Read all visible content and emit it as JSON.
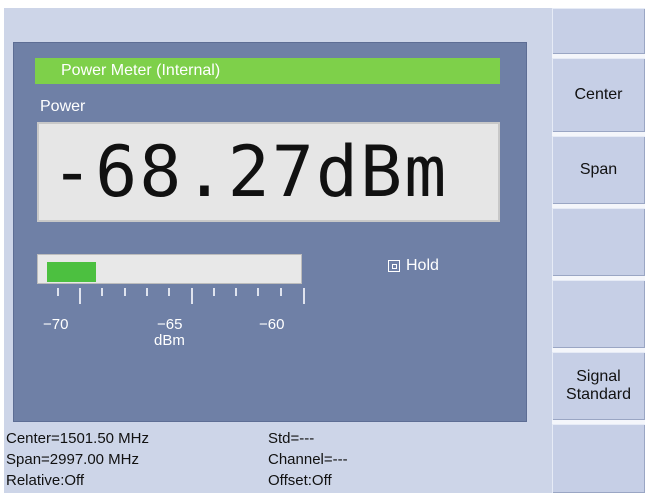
{
  "panel": {
    "title": "Power Meter (Internal)",
    "label": "Power",
    "reading": "-68.27dBm",
    "bar_level_fraction": 0.2,
    "scale_labels": [
      "−70",
      "−65",
      "−60"
    ],
    "scale_unit": "dBm",
    "hold_label": "Hold"
  },
  "softkeys": [
    "Center",
    "Span",
    "",
    "",
    "Signal\nStandard",
    ""
  ],
  "status": {
    "left": [
      "Center=1501.50 MHz",
      "Span=2997.00 MHz",
      "Relative:Off"
    ],
    "right": [
      "Std=---",
      "Channel=---",
      "Offset:Off"
    ]
  },
  "colors": {
    "panel": "#6f80a6",
    "title_bar": "#7ed04a",
    "bar": "#4cc040"
  }
}
